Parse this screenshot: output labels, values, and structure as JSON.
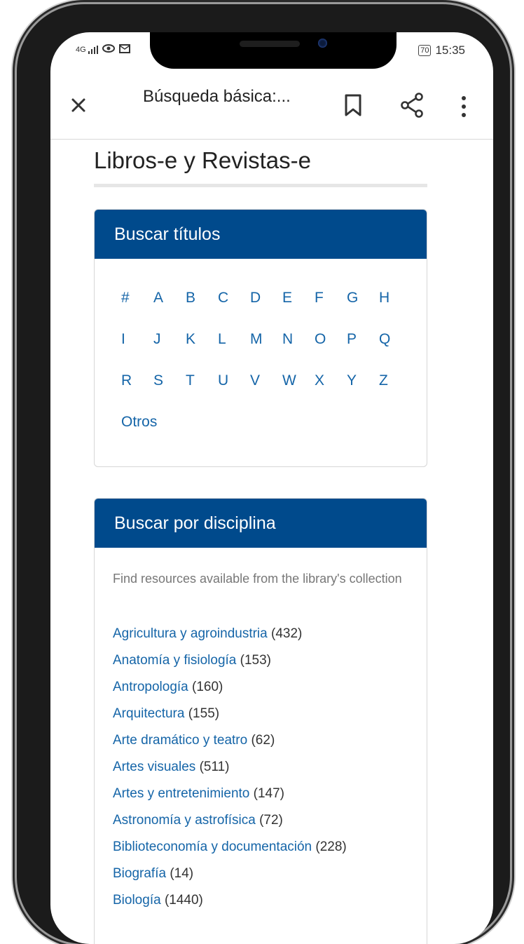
{
  "status_bar": {
    "left_icons": [
      "signal-icon",
      "eye-icon",
      "mail-icon"
    ],
    "signal_label": "4G",
    "battery": "70",
    "time": "15:35"
  },
  "app_bar": {
    "title": "Búsqueda básica:...",
    "icons": [
      "close-icon",
      "bookmark-icon",
      "share-icon",
      "more-vert-icon"
    ]
  },
  "page": {
    "heading": "Libros-e y Revistas-e"
  },
  "titles_panel": {
    "title": "Buscar títulos",
    "letters": [
      "#",
      "A",
      "B",
      "C",
      "D",
      "E",
      "F",
      "G",
      "H",
      "I",
      "J",
      "K",
      "L",
      "M",
      "N",
      "O",
      "P",
      "Q",
      "R",
      "S",
      "T",
      "U",
      "V",
      "W",
      "X",
      "Y",
      "Z"
    ],
    "other": "Otros"
  },
  "discipline_panel": {
    "title": "Buscar por disciplina",
    "description": "Find resources available from the library's collection",
    "items": [
      {
        "label": "Agricultura y agroindustria",
        "count": "(432)"
      },
      {
        "label": "Anatomía y fisiología",
        "count": "(153)"
      },
      {
        "label": "Antropología",
        "count": "(160)"
      },
      {
        "label": "Arquitectura",
        "count": "(155)"
      },
      {
        "label": "Arte dramático y teatro",
        "count": "(62)"
      },
      {
        "label": "Artes visuales",
        "count": "(511)"
      },
      {
        "label": "Artes y entretenimiento",
        "count": "(147)"
      },
      {
        "label": "Astronomía y astrofísica",
        "count": "(72)"
      },
      {
        "label": "Biblioteconomía y documentación",
        "count": "(228)"
      },
      {
        "label": "Biografía",
        "count": "(14)"
      },
      {
        "label": "Biología",
        "count": "(1440)"
      }
    ]
  },
  "colors": {
    "accent": "#004a8c",
    "link": "#1565a8",
    "frame": "#1b1b1b"
  }
}
